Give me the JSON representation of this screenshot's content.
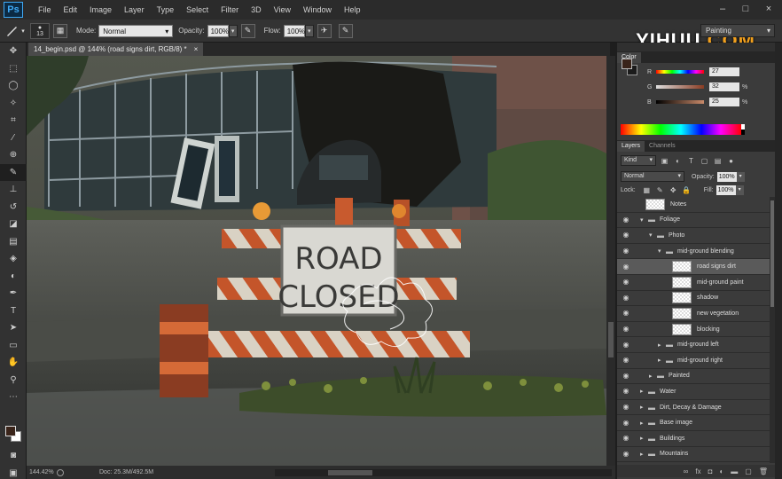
{
  "menubar": {
    "logo": "Ps",
    "items": [
      "File",
      "Edit",
      "Image",
      "Layer",
      "Type",
      "Select",
      "Filter",
      "3D",
      "View",
      "Window",
      "Help"
    ],
    "window_controls": [
      "–",
      "□",
      "×"
    ]
  },
  "options": {
    "brush_size": "13",
    "mode_label": "Mode:",
    "mode_value": "Normal",
    "opacity_label": "Opacity:",
    "opacity_value": "100%",
    "flow_label": "Flow:",
    "flow_value": "100%",
    "workspace": "Painting"
  },
  "watermark": {
    "part1": "YIHUU",
    "part2": ".COM"
  },
  "document": {
    "tab_title": "14_begin.psd @ 144% (road signs dirt, RGB/8) *",
    "close": "×",
    "sign_line1": "ROAD",
    "sign_line2": "CLOSED"
  },
  "status": {
    "zoom": "144.42%",
    "doc": "Doc: 25.3M/492.5M"
  },
  "color_panel": {
    "tabs": [
      "Color"
    ],
    "fg_color": "#3a241a",
    "sliders": [
      {
        "label": "R",
        "value": "27",
        "unit": ""
      },
      {
        "label": "G",
        "value": "32",
        "unit": "%"
      },
      {
        "label": "B",
        "value": "25",
        "unit": "%"
      }
    ]
  },
  "layers_panel": {
    "tabs": [
      "Layers",
      "Channels"
    ],
    "kind": "Kind",
    "blend_mode": "Normal",
    "opacity_label": "Opacity:",
    "opacity_value": "100%",
    "lock_label": "Lock:",
    "fill_label": "Fill:",
    "fill_value": "100%",
    "layers": [
      {
        "name": "Notes",
        "type": "layer",
        "indent": 0,
        "visible": false,
        "expanded": false,
        "selected": false
      },
      {
        "name": "Foliage",
        "type": "group",
        "indent": 0,
        "visible": true,
        "expanded": true,
        "selected": false
      },
      {
        "name": "Photo",
        "type": "group",
        "indent": 1,
        "visible": true,
        "expanded": true,
        "selected": false
      },
      {
        "name": "mid-ground blending",
        "type": "group",
        "indent": 2,
        "visible": true,
        "expanded": true,
        "selected": false
      },
      {
        "name": "road signs dirt",
        "type": "layer",
        "indent": 3,
        "visible": true,
        "expanded": false,
        "selected": true
      },
      {
        "name": "mid-ground paint",
        "type": "layer",
        "indent": 3,
        "visible": true,
        "expanded": false,
        "selected": false
      },
      {
        "name": "shadow",
        "type": "layer",
        "indent": 3,
        "visible": true,
        "expanded": false,
        "selected": false
      },
      {
        "name": "new vegetation",
        "type": "layer",
        "indent": 3,
        "visible": true,
        "expanded": false,
        "selected": false
      },
      {
        "name": "blocking",
        "type": "layer",
        "indent": 3,
        "visible": true,
        "expanded": false,
        "selected": false
      },
      {
        "name": "mid-ground left",
        "type": "group",
        "indent": 2,
        "visible": true,
        "expanded": false,
        "selected": false
      },
      {
        "name": "mid-ground right",
        "type": "group",
        "indent": 2,
        "visible": true,
        "expanded": false,
        "selected": false
      },
      {
        "name": "Painted",
        "type": "group",
        "indent": 1,
        "visible": true,
        "expanded": false,
        "selected": false
      },
      {
        "name": "Water",
        "type": "group",
        "indent": 0,
        "visible": true,
        "expanded": false,
        "selected": false
      },
      {
        "name": "Dirt, Decay & Damage",
        "type": "group",
        "indent": 0,
        "visible": true,
        "expanded": false,
        "selected": false
      },
      {
        "name": "Base image",
        "type": "group",
        "indent": 0,
        "visible": true,
        "expanded": false,
        "selected": false
      },
      {
        "name": "Buildings",
        "type": "group",
        "indent": 0,
        "visible": true,
        "expanded": false,
        "selected": false
      },
      {
        "name": "Mountains",
        "type": "group",
        "indent": 0,
        "visible": true,
        "expanded": false,
        "selected": false
      }
    ],
    "footer_icons": [
      "link-icon",
      "fx-icon",
      "mask-icon",
      "adjustment-icon",
      "new-group-icon",
      "new-layer-icon",
      "trash-icon"
    ]
  }
}
